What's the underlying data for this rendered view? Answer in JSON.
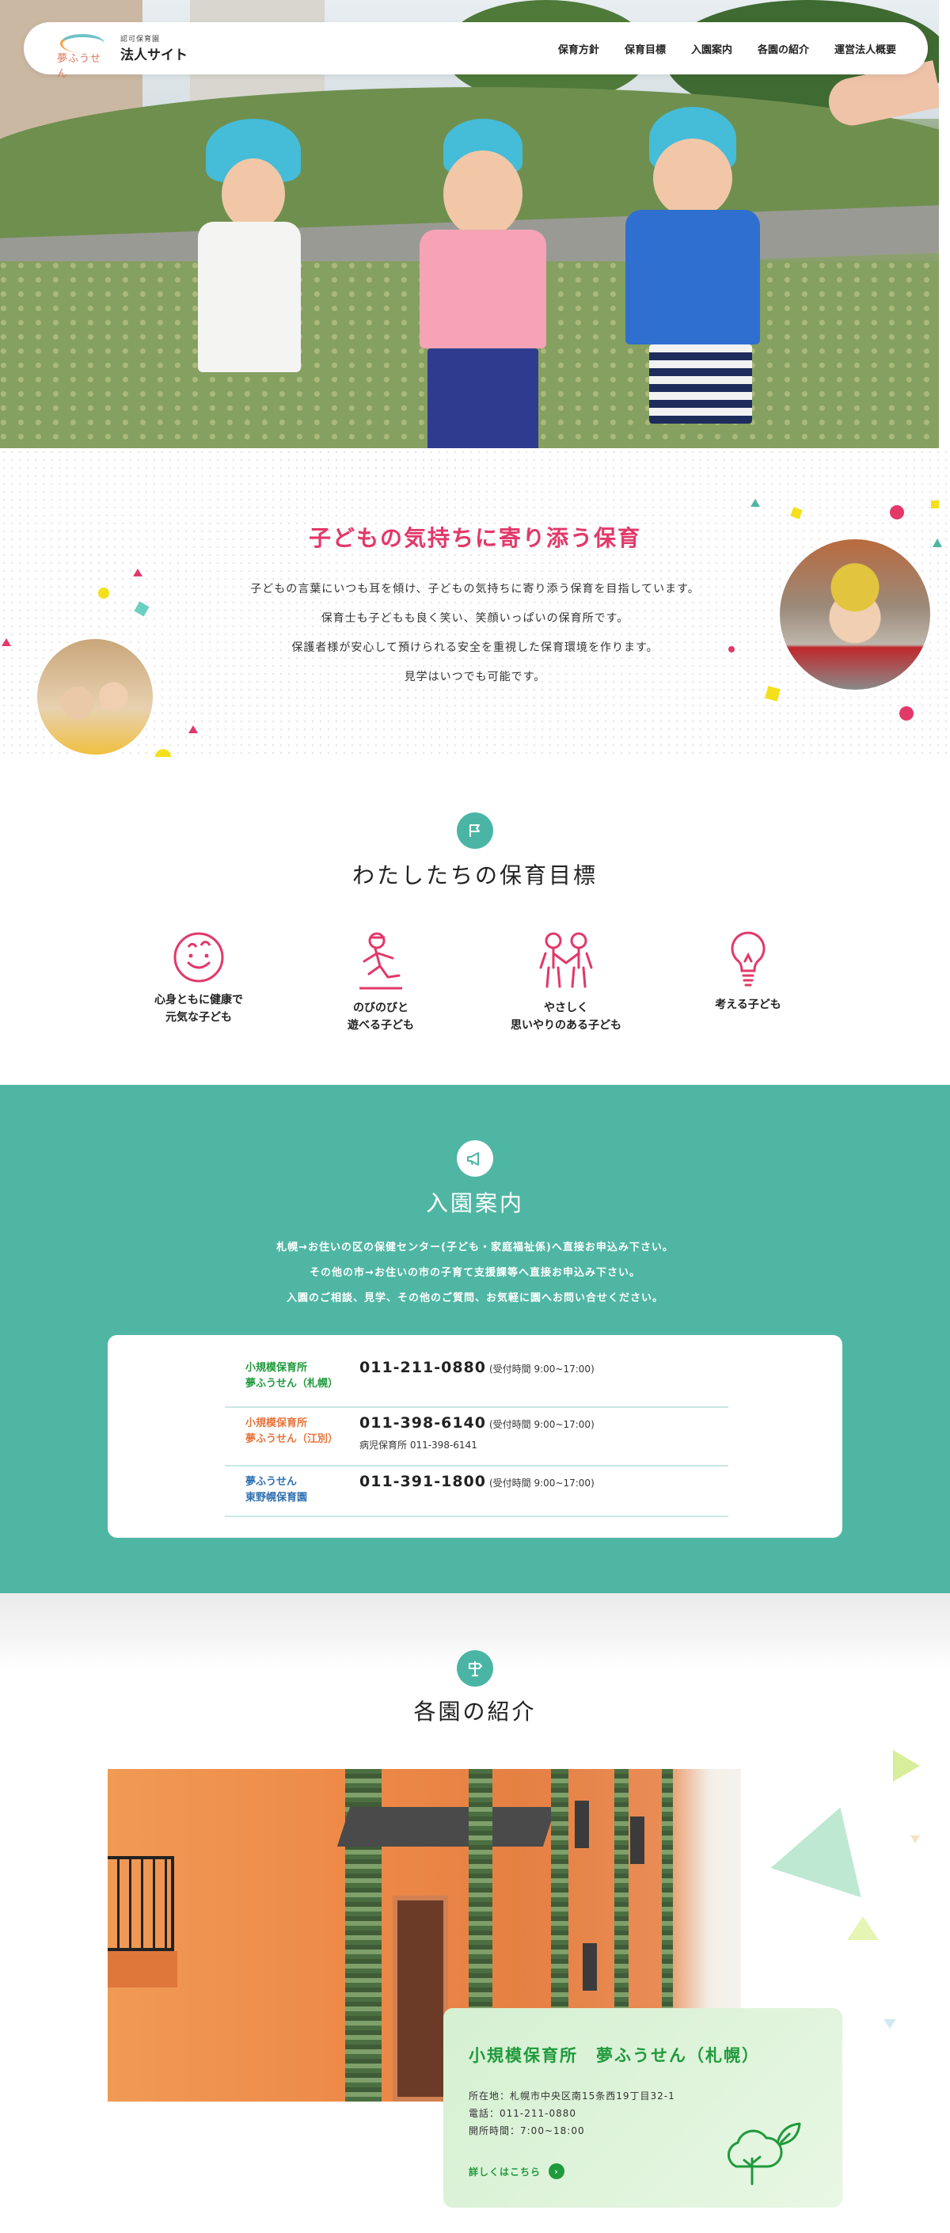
{
  "header": {
    "logo_mark": "夢ふうせん",
    "logo_sub": "認可保育園",
    "logo_main": "法人サイト",
    "nav": [
      "保育方針",
      "保育目標",
      "入園案内",
      "各園の紹介",
      "運営法人概要"
    ]
  },
  "intro": {
    "heading": "子どもの気持ちに寄り添う保育",
    "lines": [
      "子どもの言葉にいつも耳を傾け、子どもの気持ちに寄り添う保育を目指しています。",
      "保育士も子どもも良く笑い、笑顔いっぱいの保育所です。",
      "保護者様が安心して預けられる安全を重視した保育環境を作ります。",
      "見学はいつでも可能です。"
    ]
  },
  "goals": {
    "heading": "わたしたちの保育目標",
    "items": [
      {
        "label": "心身ともに健康で\n元気な子ども",
        "icon": "smile-face-icon"
      },
      {
        "label": "のびのびと\n遊べる子ども",
        "icon": "running-child-icon"
      },
      {
        "label": "やさしく\n思いやりのある子ども",
        "icon": "holding-hands-icon"
      },
      {
        "label": "考える子ども",
        "icon": "lightbulb-icon"
      }
    ]
  },
  "admission": {
    "heading": "入園案内",
    "lines": [
      "札幌→お住いの区の保健センター(子ども・家庭福祉係)へ直接お申込み下さい。",
      "その他の市→お住いの市の子育て支援課等へ直接お申込み下さい。",
      "入園のご相談、見学、その他のご質問、お気軽に園へお問い合せください。"
    ],
    "contacts": [
      {
        "name": "小規模保育所\n夢ふうせん（札幌）",
        "phone": "011-211-0880",
        "hours": "(受付時間 9:00~17:00)",
        "note": "",
        "color": "#1f9a3c"
      },
      {
        "name": "小規模保育所\n夢ふうせん（江別）",
        "phone": "011-398-6140",
        "hours": "(受付時間 9:00~17:00)",
        "note": "病児保育所 011-398-6141",
        "color": "#e8743b"
      },
      {
        "name": "夢ふうせん\n東野幌保育園",
        "phone": "011-391-1800",
        "hours": "(受付時間 9:00~17:00)",
        "note": "",
        "color": "#2d6fb0"
      }
    ]
  },
  "facilities": {
    "heading": "各園の紹介",
    "card": {
      "title": "小規模保育所　夢ふうせん（札幌）",
      "address": "所在地：札幌市中央区南15条西19丁目32-1",
      "phone": "電話：011-211-0880",
      "hours": "開所時間：7:00~18:00",
      "more": "詳しくはこちら"
    }
  },
  "colors": {
    "accent_pink": "#e2386a",
    "teal": "#4fb6a4",
    "green": "#1f9a3c"
  }
}
